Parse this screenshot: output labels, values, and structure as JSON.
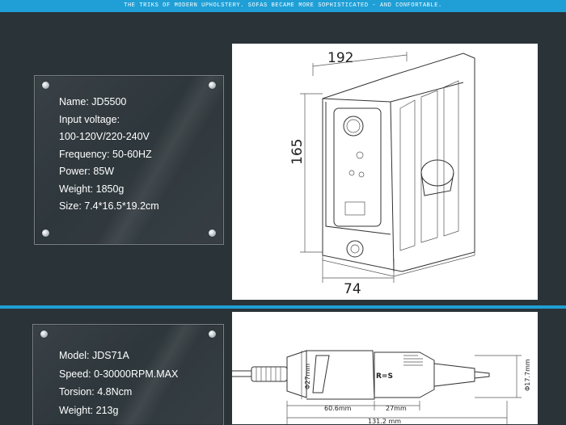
{
  "banner": {
    "text": "THE TRIKS OF MODERN UPHOLSTERY. SOFAS BECAME MORE SOPHISTICATED - AND CONFORTABLE."
  },
  "panel1": {
    "specs": [
      "Name: JD5500",
      "Input voltage:",
      "100-120V/220-240V",
      "Frequency: 50-60HZ",
      "Power: 85W",
      "Weight: 1850g",
      "Size: 7.4*16.5*19.2cm"
    ]
  },
  "panel2": {
    "specs": [
      "Model: JDS71A",
      "Speed: 0-30000RPM.MAX",
      "Torsion: 4.8Ncm",
      "Weight: 213g"
    ]
  },
  "drawing1": {
    "dim_width": "192",
    "dim_height": "165",
    "dim_depth": "74"
  },
  "drawing2": {
    "dim_diam_left": "Φ27mm",
    "dim_diam_right": "Φ17.7mm",
    "dim_body": "60.6mm",
    "dim_grip": "27mm",
    "dim_total": "131.2 mm",
    "grip_label": "R=S"
  },
  "colors": {
    "background": "#2a3338",
    "accent": "#1f9fd6",
    "text": "#ffffff"
  }
}
